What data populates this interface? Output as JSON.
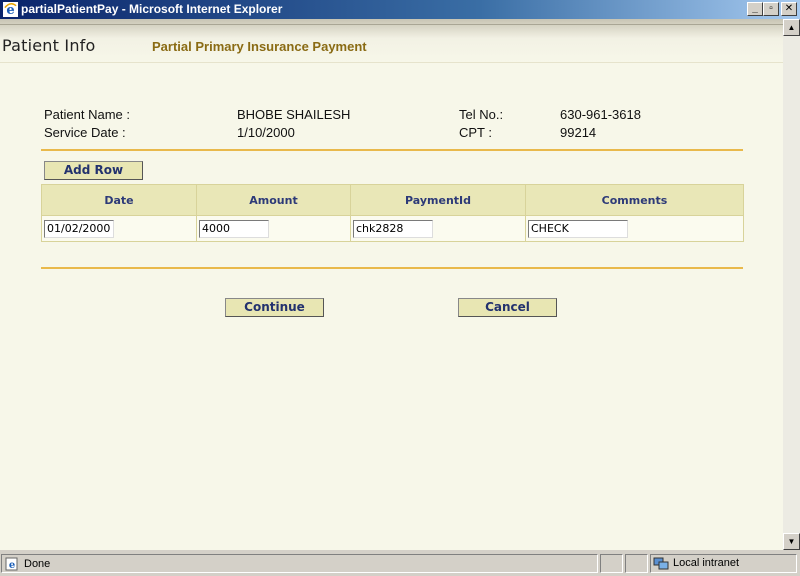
{
  "window": {
    "title": "partialPatientPay - Microsoft Internet Explorer",
    "min_label": "_",
    "max_label": "▫",
    "close_label": "✕"
  },
  "header": {
    "app_title": "Patient Info",
    "page_subtitle": "Partial Primary Insurance Payment"
  },
  "patient": {
    "name_label": "Patient Name :",
    "name_value": "BHOBE SHAILESH",
    "tel_label": "Tel No.:",
    "tel_value": "630-961-3618",
    "service_date_label": "Service Date :",
    "service_date_value": "1/10/2000",
    "cpt_label": "CPT :",
    "cpt_value": "99214"
  },
  "grid": {
    "add_row_label": "Add Row",
    "columns": [
      "Date",
      "Amount",
      "PaymentId",
      "Comments"
    ],
    "rows": [
      {
        "date": "01/02/2000",
        "amount": "4000",
        "payment_id": "chk2828",
        "comments": "CHECK"
      }
    ]
  },
  "actions": {
    "continue_label": "Continue",
    "cancel_label": "Cancel"
  },
  "statusbar": {
    "status_text": "Done",
    "zone_text": "Local intranet"
  },
  "colors": {
    "page_bg": "#f7f7e9",
    "accent_rule": "#e9b94b",
    "button_bg": "#e8e6b3",
    "button_text": "#23326e",
    "subtitle_text": "#8a6b14"
  },
  "icons": {
    "browser": "ie-icon",
    "status_page": "ie-page-icon",
    "zone": "intranet-zone-icon"
  }
}
